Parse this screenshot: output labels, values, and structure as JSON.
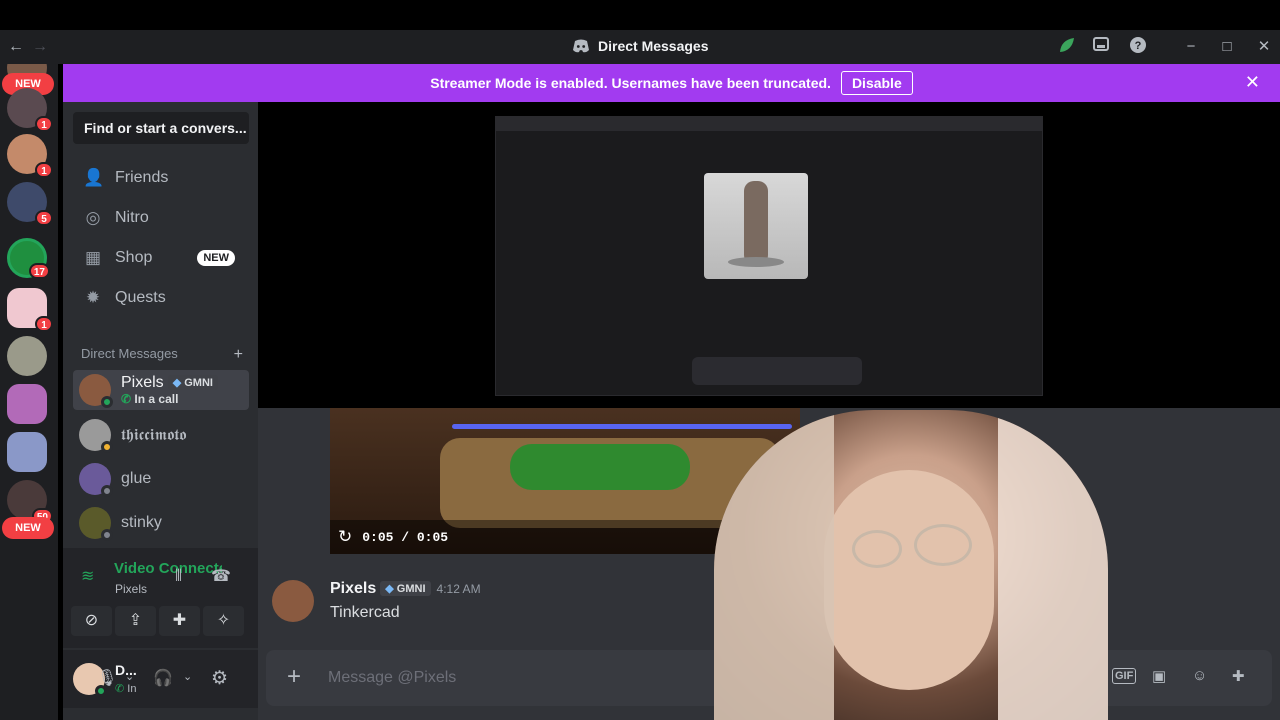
{
  "titlebar": {
    "title": "Direct Messages",
    "back": "←",
    "forward": "→",
    "minimize": "−",
    "maximize": "□",
    "close": "✕"
  },
  "banner": {
    "text": "Streamer Mode is enabled. Usernames have been truncated.",
    "button": "Disable",
    "close": "✕"
  },
  "servers": {
    "new_top": "NEW",
    "badges": [
      "1",
      "1",
      "1",
      "5",
      "17",
      "1",
      "50"
    ],
    "new_bottom": "NEW"
  },
  "sidebar": {
    "search": "Find or start a convers...",
    "nav": [
      {
        "label": "Friends",
        "icon": "friends-icon"
      },
      {
        "label": "Nitro",
        "icon": "nitro-icon"
      },
      {
        "label": "Shop",
        "icon": "shop-icon",
        "badge": "NEW"
      },
      {
        "label": "Quests",
        "icon": "quests-icon"
      }
    ],
    "dm_header": "Direct Messages",
    "dm_add": "+",
    "dms": [
      {
        "name": "Pixels",
        "tag": "GMNI",
        "sub": "In a call",
        "status": "online"
      },
      {
        "name": "𝖙𝖍𝖎𝖈𝖈𝖎𝖒𝖔𝖙𝖔",
        "status": "idle"
      },
      {
        "name": "glue",
        "status": "offline"
      },
      {
        "name": "stinky",
        "status": "offline"
      }
    ]
  },
  "voice": {
    "title": "Video Connected",
    "subtitle": "Pixels"
  },
  "user": {
    "name": "D...",
    "status": "In"
  },
  "video": {
    "time": "0:05 / 0:05",
    "progress": 1.0
  },
  "message": {
    "author": "Pixels",
    "tag": "GMNI",
    "time": "4:12 AM",
    "text": "Tinkercad"
  },
  "composer": {
    "add": "+",
    "placeholder": "Message @Pixels",
    "gif": "GIF"
  },
  "colors": {
    "banner": "#a23bf0",
    "online": "#23a55a",
    "accent": "#5865f2",
    "badge": "#f23f43"
  }
}
